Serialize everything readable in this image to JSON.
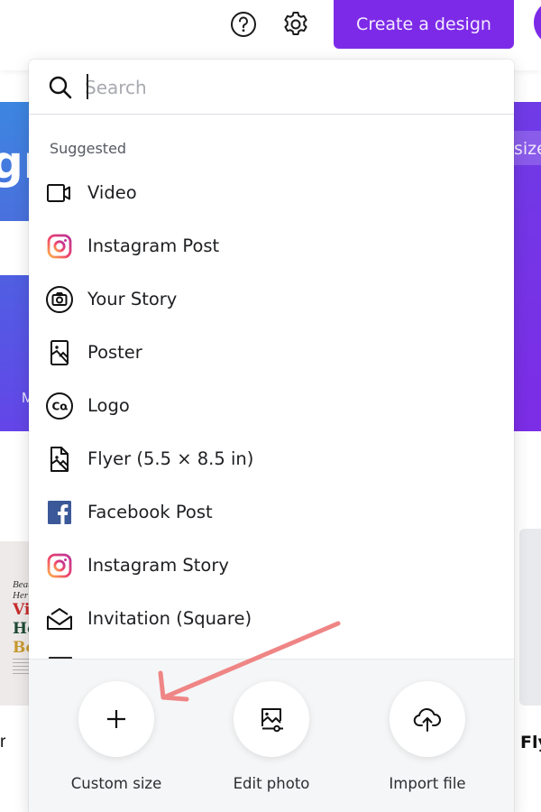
{
  "topbar": {
    "help_icon": "question-circle-icon",
    "settings_icon": "gear-icon",
    "create_button_label": "Create a design",
    "brand_color": "#7d2ae8"
  },
  "background": {
    "left_banner_text": "gr",
    "right_banner_text": "size",
    "left_card_text": "M",
    "left_thumb_lines": [
      "Beau",
      "Her"
    ],
    "left_thumb_big": [
      "Vi",
      "Ho",
      "Bo"
    ],
    "left_label": "r",
    "right_label": "Fly"
  },
  "search": {
    "placeholder": "Search",
    "value": ""
  },
  "suggested": {
    "heading": "Suggested",
    "items": [
      {
        "label": "Video",
        "icon": "video-camera-icon"
      },
      {
        "label": "Instagram Post",
        "icon": "instagram-icon"
      },
      {
        "label": "Your Story",
        "icon": "camera-circle-icon"
      },
      {
        "label": "Poster",
        "icon": "poster-image-icon"
      },
      {
        "label": "Logo",
        "icon": "logo-co-icon"
      },
      {
        "label": "Flyer (5.5 × 8.5 in)",
        "icon": "flyer-document-icon"
      },
      {
        "label": "Facebook Post",
        "icon": "facebook-icon"
      },
      {
        "label": "Instagram Story",
        "icon": "instagram-icon"
      },
      {
        "label": "Invitation (Square)",
        "icon": "envelope-icon"
      }
    ]
  },
  "actions": [
    {
      "label": "Custom size",
      "icon": "plus-icon"
    },
    {
      "label": "Edit photo",
      "icon": "edit-photo-icon"
    },
    {
      "label": "Import file",
      "icon": "cloud-upload-icon"
    }
  ],
  "annotation": {
    "arrow_color": "#ef8585",
    "points_to": "Custom size"
  }
}
